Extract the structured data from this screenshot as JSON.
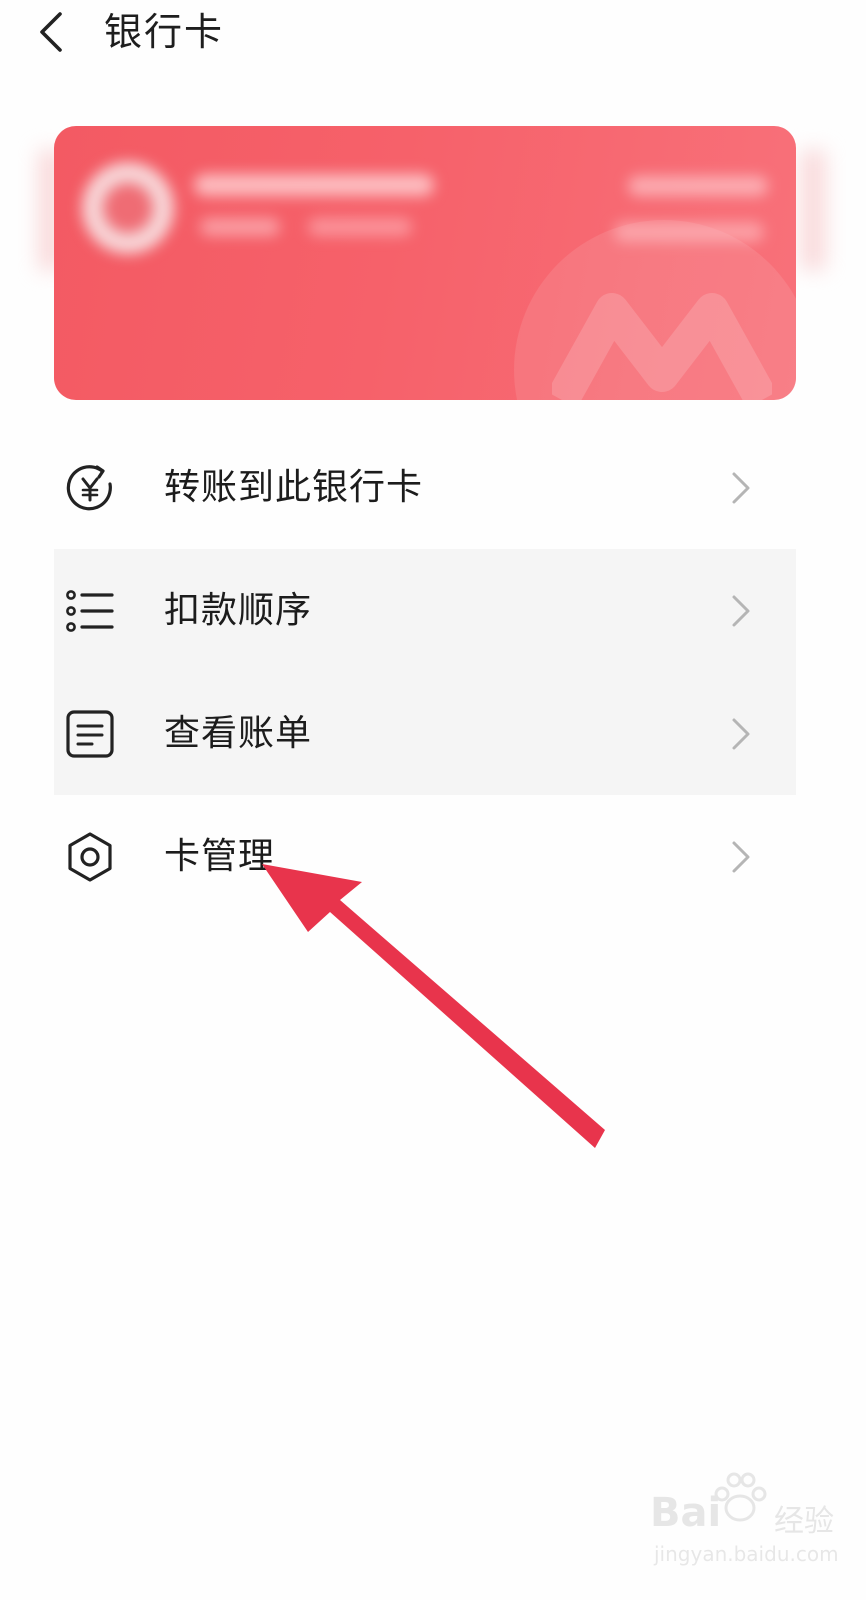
{
  "header": {
    "title": "银行卡",
    "back_icon": "chevron-left-icon"
  },
  "card": {
    "background_color": "#f35a63",
    "details_obscured": true
  },
  "menu": [
    {
      "label": "转账到此银行卡",
      "icon": "yuan-transfer-icon"
    },
    {
      "label": "扣款顺序",
      "icon": "list-icon"
    },
    {
      "label": "查看账单",
      "icon": "document-icon"
    },
    {
      "label": "卡管理",
      "icon": "gear-icon"
    }
  ],
  "annotation": {
    "type": "arrow",
    "color": "#e8344c",
    "points_to": "卡管理"
  },
  "watermark": {
    "brand": "Bai",
    "suffix": "经验",
    "url": "jingyan.baidu.com"
  }
}
